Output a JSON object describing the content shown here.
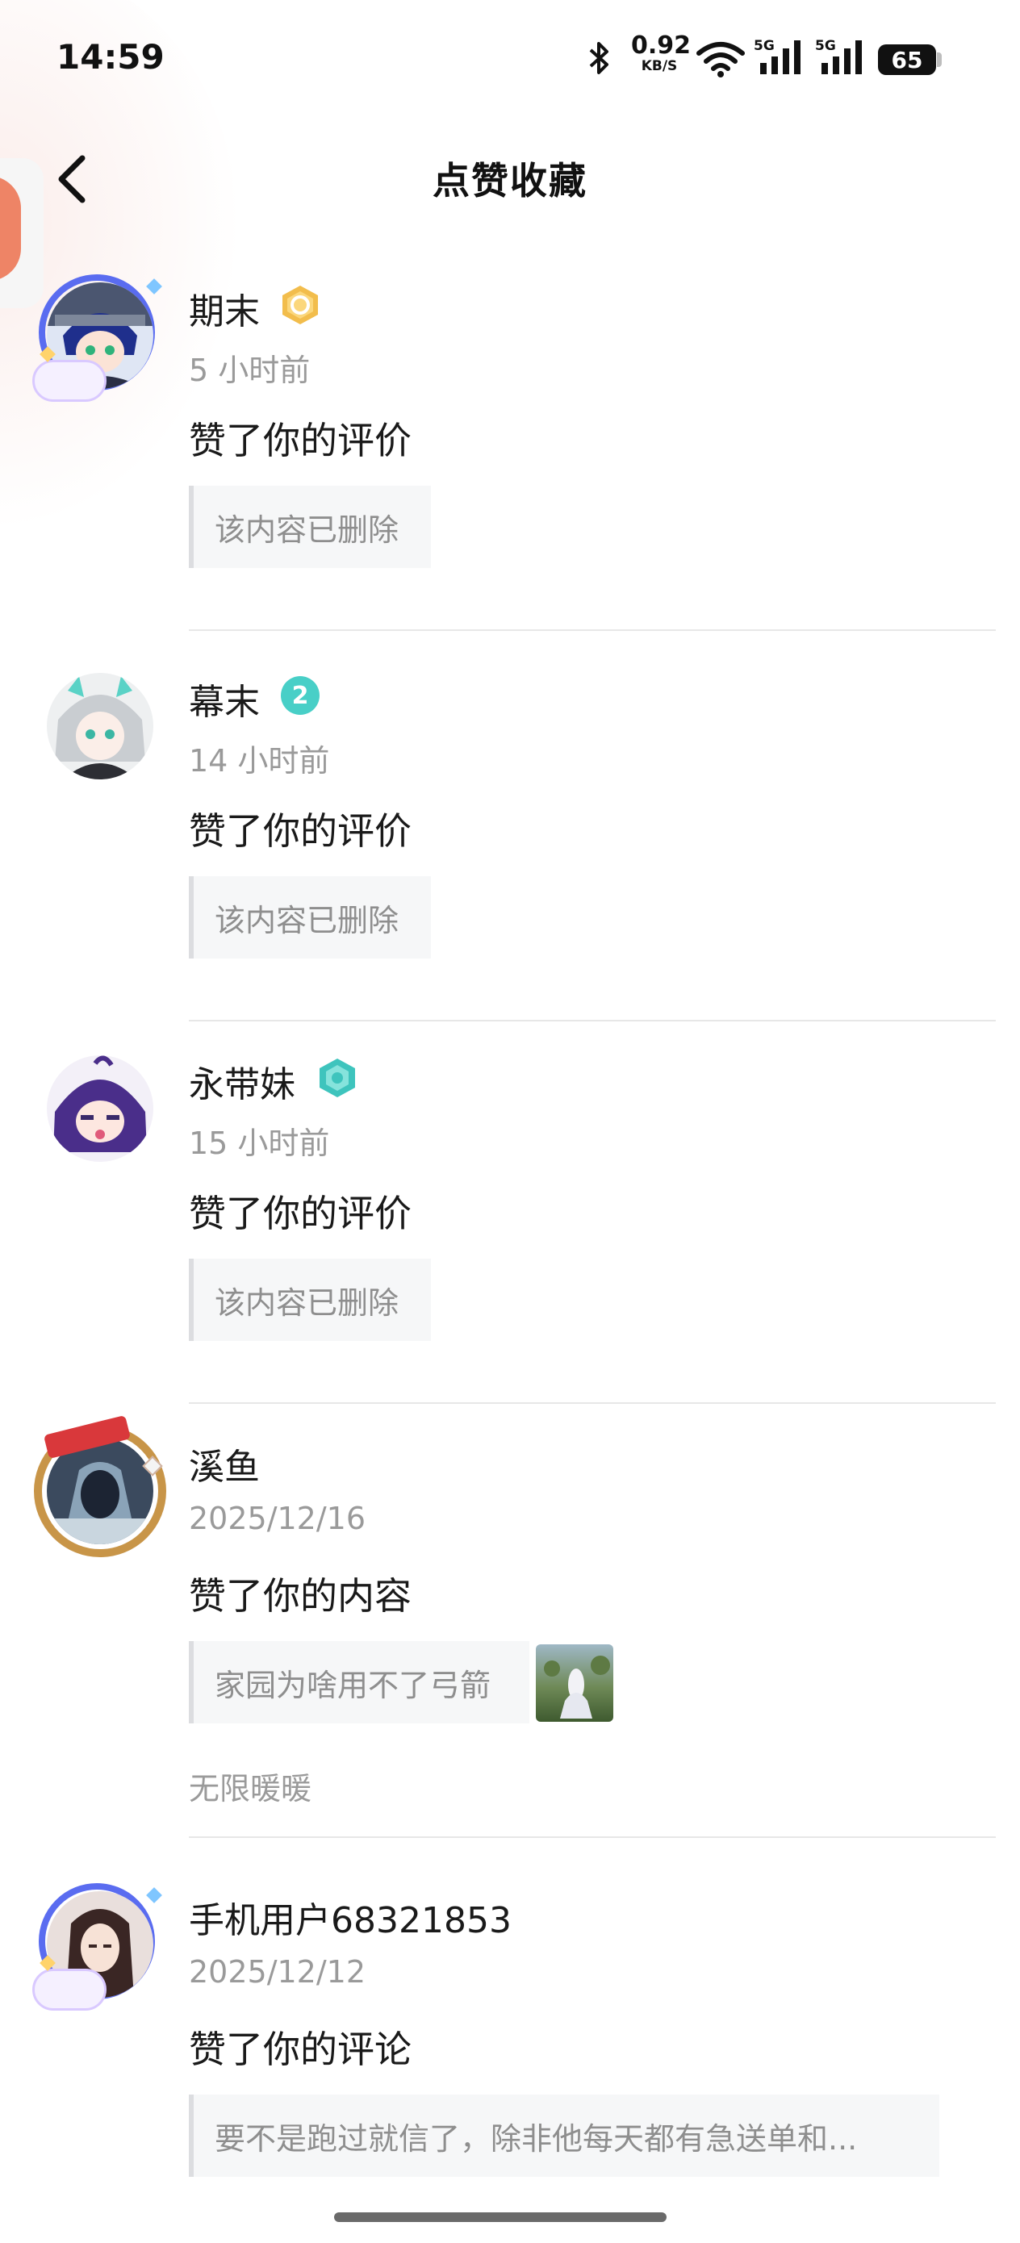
{
  "status_bar": {
    "time": "14:59",
    "net_speed": "0.92",
    "net_unit": "KB/S",
    "signal_1": "5G",
    "signal_2": "5G",
    "battery": "65"
  },
  "header": {
    "title": "点赞收藏"
  },
  "notifications": [
    {
      "username": "期末",
      "badge": "gold-level-badge",
      "time": "5 小时前",
      "action": "赞了你的评价",
      "quote": "该内容已删除"
    },
    {
      "username": "幕末",
      "badge": "level-2-badge",
      "time": "14 小时前",
      "action": "赞了你的评价",
      "quote": "该内容已删除"
    },
    {
      "username": "永带妹",
      "badge": "teal-gem-badge",
      "time": "15 小时前",
      "action": "赞了你的评价",
      "quote": "该内容已删除"
    },
    {
      "username": "溪鱼",
      "time": "2025/12/16",
      "action": "赞了你的内容",
      "quote": "家园为啥用不了弓箭",
      "source": "无限暖暖"
    },
    {
      "username": "手机用户68321853",
      "time": "2025/12/12",
      "action": "赞了你的评论",
      "quote": "要不是跑过就信了，除非他每天都有急送单和..."
    }
  ],
  "level_badge_digit": "2",
  "colors": {
    "accent_blue_frame": "#5a6cf0",
    "gold_badge": "#e8b04a",
    "teal_badge": "#3cc9c3",
    "text_secondary": "#9a9a9a"
  }
}
